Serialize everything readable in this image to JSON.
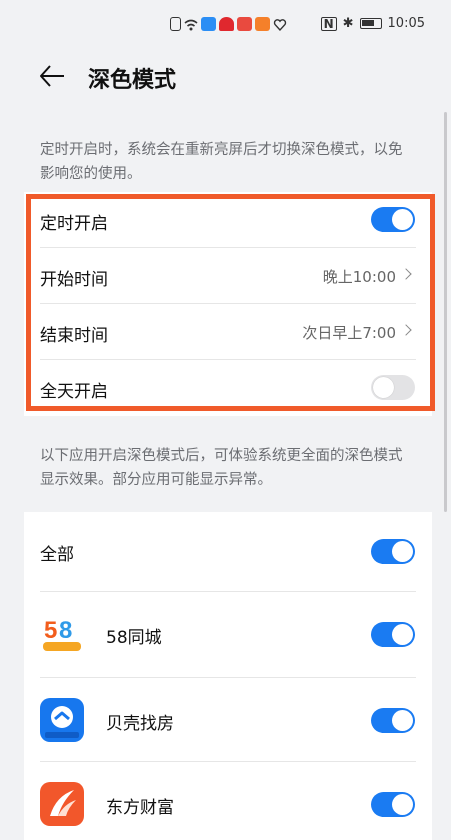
{
  "status_bar": {
    "time": "10:05",
    "icons": [
      "sim-icon",
      "wifi-icon",
      "cloud-icon",
      "huawei-icon",
      "message-icon",
      "video-icon",
      "heart-icon",
      "nfc-icon",
      "bluetooth-icon",
      "battery-icon"
    ]
  },
  "header": {
    "title": "深色模式"
  },
  "schedule": {
    "description": "定时开启时，系统会在重新亮屏后才切换深色模式，以免影响您的使用。",
    "rows": [
      {
        "label": "定时开启",
        "type": "toggle",
        "on": true
      },
      {
        "label": "开始时间",
        "type": "value",
        "value": "晚上10:00"
      },
      {
        "label": "结束时间",
        "type": "value",
        "value": "次日早上7:00"
      },
      {
        "label": "全天开启",
        "type": "toggle",
        "on": false
      }
    ],
    "highlight_color": "#f05a2a"
  },
  "apps": {
    "description": "以下应用开启深色模式后，可体验系统更全面的深色模式显示效果。部分应用可能显示异常。",
    "all_label": "全部",
    "all_on": true,
    "items": [
      {
        "label": "58同城",
        "icon": "58-logo-icon",
        "on": true
      },
      {
        "label": "贝壳找房",
        "icon": "beike-house-icon",
        "on": true
      },
      {
        "label": "东方财富",
        "icon": "eastmoney-icon",
        "on": true
      }
    ]
  },
  "colors": {
    "accent": "#1a7bf2",
    "background": "#f1f2f4"
  }
}
